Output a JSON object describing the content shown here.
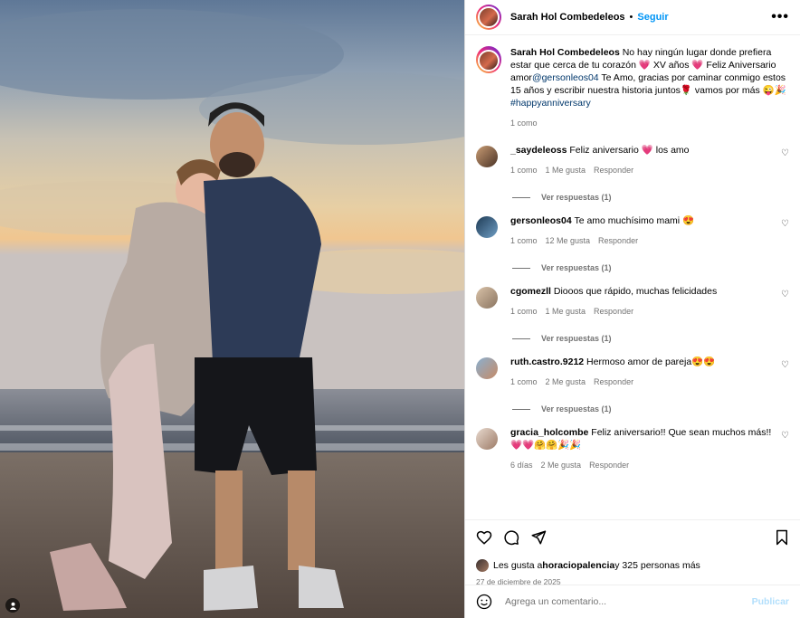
{
  "post": {
    "author": "Sarah Hol Combedeleos",
    "follow_label": "Seguir",
    "separator": "•",
    "more_label": "•••"
  },
  "caption": {
    "author": "Sarah Hol Combedeleos",
    "text_1": "No hay ningún lugar donde prefiera estar que cerca de tu corazón 💗 XV años 💗 Feliz Aniversario amor",
    "mention": "@gersonleos04",
    "text_2": " Te Amo, gracias por caminar conmigo estos 15 años y escribir nuestra historia juntos🌹 vamos por más 😜🎉 ",
    "hashtag": "#happyanniversary",
    "likes": "1 como"
  },
  "comments": [
    {
      "user": "_saydeleoss",
      "text": "Feliz aniversario 💗 los amo",
      "likes": "1 como",
      "age": "1 Me gusta",
      "reply": "Responder",
      "replies": "Ver respuestas (1)"
    },
    {
      "user": "gersonleos04",
      "text": "Te amo muchísimo mami 😍",
      "likes": "1 como",
      "age": "12 Me gusta",
      "reply": "Responder",
      "replies": "Ver respuestas (1)"
    },
    {
      "user": "cgomezll",
      "text": "Diooos que rápido, muchas felicidades",
      "likes": "1 como",
      "age": "1 Me gusta",
      "reply": "Responder",
      "replies": "Ver respuestas (1)"
    },
    {
      "user": "ruth.castro.9212",
      "text": "Hermoso amor de pareja😍😍",
      "likes": "1 como",
      "age": "2 Me gusta",
      "reply": "Responder",
      "replies": "Ver respuestas (1)"
    },
    {
      "user": "gracia_holcombe",
      "text": "Feliz aniversario!! Que sean muchos más!! 💗💗🤗🤗🎉🎉",
      "likes": "6 días",
      "age": "2 Me gusta",
      "reply": "Responder",
      "replies": ""
    }
  ],
  "likes_line": {
    "prefix": "Les gusta a ",
    "user": "horaciopalencia",
    "suffix": " y 325 personas más"
  },
  "date": "27 de diciembre de 2025",
  "add_comment": {
    "placeholder": "Agrega un comentario...",
    "post_label": "Publicar"
  },
  "colors": {
    "accent": "#0095f6",
    "link": "#00376b",
    "muted": "#737373",
    "post_disabled": "#b2dffc"
  },
  "icons": [
    "heart-icon",
    "comment-icon",
    "share-icon",
    "bookmark-icon",
    "emoji-icon",
    "more-icon",
    "user-tag-icon"
  ]
}
